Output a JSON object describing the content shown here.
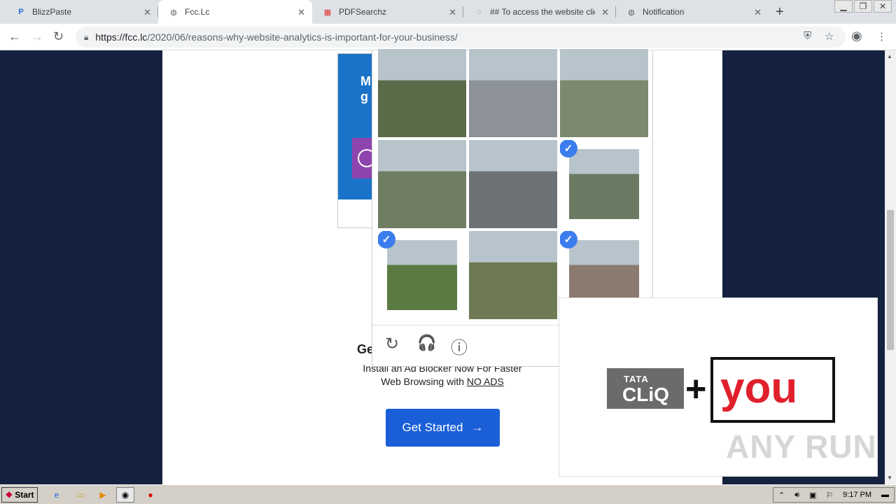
{
  "browser": {
    "tabs": [
      {
        "title": "BlizzPaste",
        "icon": "blizzpaste-icon",
        "active": false
      },
      {
        "title": "Fcc.Lc",
        "icon": "globe-icon",
        "active": true
      },
      {
        "title": "PDFSearchz",
        "icon": "pdf-icon",
        "active": false
      },
      {
        "title": "## To access the website click t",
        "icon": "loading-icon",
        "active": false
      },
      {
        "title": "Notification",
        "icon": "globe-icon",
        "active": false
      }
    ],
    "new_tab": "+",
    "url_domain": "https://fcc.lc",
    "url_path": "/2020/06/reasons-why-website-analytics-is-important-for-your-business/"
  },
  "page": {
    "ad_text": "M\ng",
    "heading": "Ge",
    "subtext_line1": "Install an Ad Blocker Now For Faster",
    "subtext_line2": "Web Browsing with",
    "no_ads": "NO ADS",
    "get_started": "Get Started",
    "get_started_arrow": "→"
  },
  "captcha": {
    "tiles": [
      {
        "desc": "roof",
        "selected": false,
        "color": "#5a6b4a"
      },
      {
        "desc": "highway-overpass",
        "selected": false,
        "color": "#8d9298"
      },
      {
        "desc": "road-lanes",
        "selected": false,
        "color": "#7b8a6e"
      },
      {
        "desc": "highway",
        "selected": false,
        "color": "#6f7d62"
      },
      {
        "desc": "highway-guardrail",
        "selected": false,
        "color": "#6c7276"
      },
      {
        "desc": "house-tower",
        "selected": true,
        "color": "#6b7a62"
      },
      {
        "desc": "driveway-trees",
        "selected": true,
        "color": "#5b7a42"
      },
      {
        "desc": "overpass-grass",
        "selected": false,
        "color": "#6e7a54"
      },
      {
        "desc": "brick-house",
        "selected": true,
        "color": "#8a7a70"
      }
    ],
    "check_glyph": "✓",
    "reload_glyph": "↻",
    "audio_glyph": "🎧",
    "info_glyph": "ⓘ"
  },
  "popup": {
    "tata_line1": "TATA",
    "tata_line2": "CLiQ",
    "plus": "+",
    "you": "you",
    "watermark": "ANY RUN"
  },
  "taskbar": {
    "start": "Start",
    "time": "9:17 PM"
  }
}
